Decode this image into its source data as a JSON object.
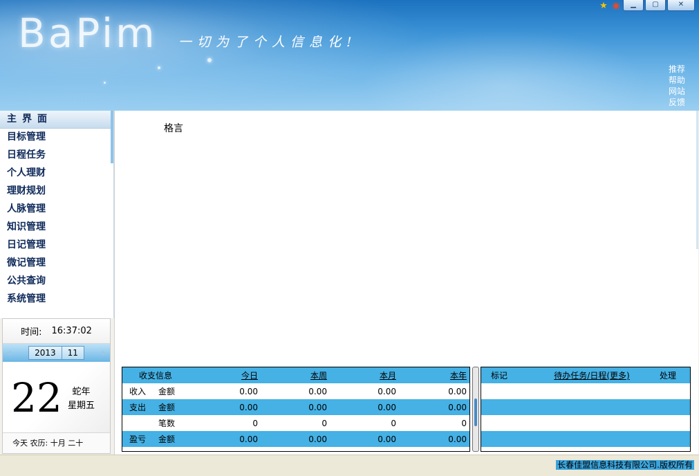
{
  "app": {
    "logo": "BaPim",
    "slogan": "一切为了个人信息化!"
  },
  "window_controls": {
    "minimize": "▁",
    "maximize": "▢",
    "close": "✕"
  },
  "top_links": [
    "推荐",
    "帮助",
    "网站",
    "反馈"
  ],
  "sidebar": {
    "items": [
      {
        "label": "主界面",
        "active": true
      },
      {
        "label": "目标管理"
      },
      {
        "label": "日程任务"
      },
      {
        "label": "个人理财"
      },
      {
        "label": "理财规划"
      },
      {
        "label": "人脉管理"
      },
      {
        "label": "知识管理"
      },
      {
        "label": "日记管理"
      },
      {
        "label": "微记管理"
      },
      {
        "label": "公共查询"
      },
      {
        "label": "系统管理"
      }
    ]
  },
  "calendar": {
    "time_label": "时间:",
    "time_value": "16:37:02",
    "year": "2013",
    "month": "11",
    "day": "22",
    "zodiac": "蛇年",
    "weekday": "星期五",
    "lunar": "今天  农历: 十月 二十"
  },
  "main": {
    "motto_label": "格言"
  },
  "finance": {
    "header": {
      "title": "收支信息",
      "today": "今日",
      "week": "本周",
      "month": "本月",
      "year": "本年"
    },
    "rows": [
      {
        "c1": "收入",
        "c2": "金额",
        "today": "0.00",
        "week": "0.00",
        "month": "0.00",
        "year": "0.00"
      },
      {
        "c1": "支出",
        "c2": "金额",
        "today": "0.00",
        "week": "0.00",
        "month": "0.00",
        "year": "0.00"
      },
      {
        "c1": "",
        "c2": "笔数",
        "today": "0",
        "week": "0",
        "month": "0",
        "year": "0"
      },
      {
        "c1": "盈亏",
        "c2": "金额",
        "today": "0.00",
        "week": "0.00",
        "month": "0.00",
        "year": "0.00"
      }
    ]
  },
  "todo": {
    "header": {
      "mark": "标记",
      "tasks": "待办任务/日程(更多)",
      "action": "处理"
    }
  },
  "status": {
    "copyright": "长春佳盟信息科技有限公司.版权所有"
  },
  "colors": {
    "row_blue": "#45b1e5",
    "nav_text": "#0f2a5a"
  }
}
